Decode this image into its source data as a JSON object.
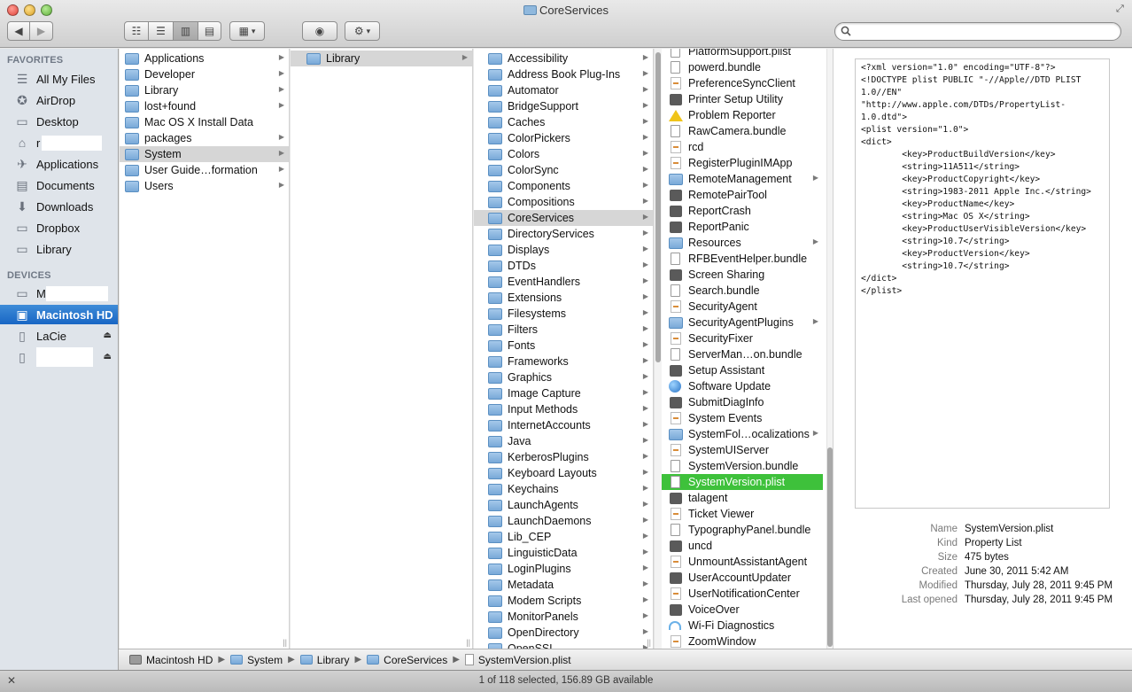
{
  "window": {
    "title": "CoreServices"
  },
  "toolbar": {
    "back_icon": "◀",
    "forward_icon": "▶",
    "view_icon": "☷",
    "view_list": "☰",
    "view_column": "▥",
    "view_cover": "▤",
    "arrange_icon": "▦",
    "arrange_caret": "▾",
    "quicklook_icon": "◉",
    "action_icon": "⚙",
    "action_caret": "▾",
    "search_placeholder": ""
  },
  "sidebar": {
    "favorites_header": "FAVORITES",
    "devices_header": "DEVICES",
    "favorites": [
      {
        "label": "All My Files",
        "icon": "☰"
      },
      {
        "label": "AirDrop",
        "icon": "✪"
      },
      {
        "label": "Desktop",
        "icon": "▭"
      },
      {
        "label": "r",
        "icon": "⌂"
      },
      {
        "label": "Applications",
        "icon": "✈"
      },
      {
        "label": "Documents",
        "icon": "▤"
      },
      {
        "label": "Downloads",
        "icon": "⬇"
      },
      {
        "label": "Dropbox",
        "icon": "▭"
      },
      {
        "label": "Library",
        "icon": "▭"
      }
    ],
    "devices": [
      {
        "label": "M",
        "icon": "▭"
      },
      {
        "label": "Macintosh HD",
        "icon": "▣"
      },
      {
        "label": "LaCie",
        "icon": "▯",
        "eject": "⏏"
      },
      {
        "label": "",
        "icon": "▯",
        "eject": "⏏"
      }
    ]
  },
  "column1": [
    {
      "label": "Applications",
      "type": "folder",
      "arrow": "▶"
    },
    {
      "label": "Developer",
      "type": "folder",
      "arrow": "▶"
    },
    {
      "label": "Library",
      "type": "folder",
      "arrow": "▶"
    },
    {
      "label": "lost+found",
      "type": "folder",
      "arrow": "▶"
    },
    {
      "label": "Mac OS X Install Data",
      "type": "folder",
      "arrow": ""
    },
    {
      "label": "packages",
      "type": "folder",
      "arrow": "▶"
    },
    {
      "label": "System",
      "type": "folder",
      "arrow": "▶"
    },
    {
      "label": "User Guide…formation",
      "type": "folder",
      "arrow": "▶"
    },
    {
      "label": "Users",
      "type": "folder",
      "arrow": "▶"
    }
  ],
  "column2": [
    {
      "label": "Library",
      "type": "folder",
      "arrow": "▶"
    }
  ],
  "column3": [
    "Accessibility",
    "Address Book Plug-Ins",
    "Automator",
    "BridgeSupport",
    "Caches",
    "ColorPickers",
    "Colors",
    "ColorSync",
    "Components",
    "Compositions",
    "CoreServices",
    "DirectoryServices",
    "Displays",
    "DTDs",
    "EventHandlers",
    "Extensions",
    "Filesystems",
    "Filters",
    "Fonts",
    "Frameworks",
    "Graphics",
    "Image Capture",
    "Input Methods",
    "InternetAccounts",
    "Java",
    "KerberosPlugins",
    "Keyboard Layouts",
    "Keychains",
    "LaunchAgents",
    "LaunchDaemons",
    "Lib_CEP",
    "LinguisticData",
    "LoginPlugins",
    "Metadata",
    "Modem Scripts",
    "MonitorPanels",
    "OpenDirectory",
    "OpenSSL"
  ],
  "column3_arrow": "▶",
  "column4": [
    {
      "label": "PlatformSupport.plist",
      "type": "doc"
    },
    {
      "label": "powerd.bundle",
      "type": "doc"
    },
    {
      "label": "PreferenceSyncClient",
      "type": "script"
    },
    {
      "label": "Printer Setup Utility",
      "type": "app"
    },
    {
      "label": "Problem Reporter",
      "type": "warn"
    },
    {
      "label": "RawCamera.bundle",
      "type": "doc"
    },
    {
      "label": "rcd",
      "type": "script"
    },
    {
      "label": "RegisterPluginIMApp",
      "type": "script"
    },
    {
      "label": "RemoteManagement",
      "type": "folder",
      "arrow": "▶"
    },
    {
      "label": "RemotePairTool",
      "type": "app"
    },
    {
      "label": "ReportCrash",
      "type": "app"
    },
    {
      "label": "ReportPanic",
      "type": "app"
    },
    {
      "label": "Resources",
      "type": "folder",
      "arrow": "▶"
    },
    {
      "label": "RFBEventHelper.bundle",
      "type": "doc"
    },
    {
      "label": "Screen Sharing",
      "type": "app"
    },
    {
      "label": "Search.bundle",
      "type": "doc"
    },
    {
      "label": "SecurityAgent",
      "type": "script"
    },
    {
      "label": "SecurityAgentPlugins",
      "type": "folder",
      "arrow": "▶"
    },
    {
      "label": "SecurityFixer",
      "type": "script"
    },
    {
      "label": "ServerMan…on.bundle",
      "type": "doc"
    },
    {
      "label": "Setup Assistant",
      "type": "app"
    },
    {
      "label": "Software Update",
      "type": "globe"
    },
    {
      "label": "SubmitDiagInfo",
      "type": "app"
    },
    {
      "label": "System Events",
      "type": "script"
    },
    {
      "label": "SystemFol…ocalizations",
      "type": "folder",
      "arrow": "▶"
    },
    {
      "label": "SystemUIServer",
      "type": "script"
    },
    {
      "label": "SystemVersion.bundle",
      "type": "doc"
    },
    {
      "label": "SystemVersion.plist",
      "type": "doc"
    },
    {
      "label": "talagent",
      "type": "app"
    },
    {
      "label": "Ticket Viewer",
      "type": "script"
    },
    {
      "label": "TypographyPanel.bundle",
      "type": "doc"
    },
    {
      "label": "uncd",
      "type": "app"
    },
    {
      "label": "UnmountAssistantAgent",
      "type": "script"
    },
    {
      "label": "UserAccountUpdater",
      "type": "app"
    },
    {
      "label": "UserNotificationCenter",
      "type": "script"
    },
    {
      "label": "VoiceOver",
      "type": "app"
    },
    {
      "label": "Wi-Fi Diagnostics",
      "type": "wifi"
    },
    {
      "label": "ZoomWindow",
      "type": "script"
    }
  ],
  "preview": {
    "content": "<?xml version=\"1.0\" encoding=\"UTF-8\"?>\n<!DOCTYPE plist PUBLIC \"-//Apple//DTD PLIST 1.0//EN\" \"http://www.apple.com/DTDs/PropertyList-1.0.dtd\">\n<plist version=\"1.0\">\n<dict>\n        <key>ProductBuildVersion</key>\n        <string>11A511</string>\n        <key>ProductCopyright</key>\n        <string>1983-2011 Apple Inc.</string>\n        <key>ProductName</key>\n        <string>Mac OS X</string>\n        <key>ProductUserVisibleVersion</key>\n        <string>10.7</string>\n        <key>ProductVersion</key>\n        <string>10.7</string>\n</dict>\n</plist>",
    "info": [
      {
        "key": "Name",
        "value": "SystemVersion.plist"
      },
      {
        "key": "Kind",
        "value": "Property List"
      },
      {
        "key": "Size",
        "value": "475 bytes"
      },
      {
        "key": "Created",
        "value": "June 30, 2011 5:42 AM"
      },
      {
        "key": "Modified",
        "value": "Thursday, July 28, 2011 9:45 PM"
      },
      {
        "key": "Last opened",
        "value": "Thursday, July 28, 2011 9:45 PM"
      }
    ]
  },
  "pathbar": {
    "items": [
      "Macintosh HD",
      "System",
      "Library",
      "CoreServices",
      "SystemVersion.plist"
    ],
    "separator": "▶"
  },
  "statusbar": {
    "text": "1 of 118 selected, 156.89 GB available",
    "toggle_icon": "✕"
  },
  "colors": {
    "selection_green": "#3ec13b",
    "sidebar_selected": "#1866c4",
    "selection_gray": "#d6d6d6"
  }
}
